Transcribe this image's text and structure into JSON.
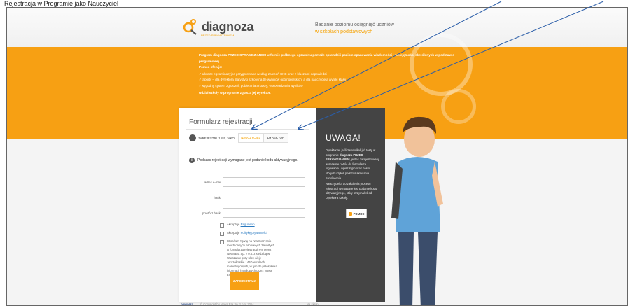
{
  "caption": "Rejestracja w Programie jako Nauczyciel",
  "header": {
    "logo_text": "diagnoza",
    "logo_subtext": "PRZED SPRAWDZIANEM",
    "tagline_line1": "Badanie poziomu osiągnięć uczniów",
    "tagline_line2": "w szkołach podstawowych"
  },
  "banner": {
    "intro": "Program diagnoza PRZED SPRAWDZIANEM w formie próbnego egzaminu pomoże sprawdzić poziom opanowania wiadomości i umiejętności określonych w podstawie programowej.",
    "offer_label": "Pomoc oferuje:",
    "items": [
      "arkusze egzaminacyjne przygotowane według zaleceń CKE oraz z kluczami odpowiedzi",
      "raporty – dla dyrektora statystyki szkoły na tle wyników ogólnopolskich, a dla nauczyciela wyniki klasy",
      "wygodny system zgłoszeń, pobierania arkuszy, wprowadzania wyników"
    ],
    "footer_note": "Udział szkoły w programie zgłasza jej Dyrektor."
  },
  "form": {
    "title": "Formularz rejestracji",
    "register_as_label": "ZAREJESTRUJ SIĘ JAKO:",
    "tab_teacher": "NAUCZYCIEL",
    "tab_director": "DYREKTOR",
    "info_text": "Podczas rejestracji wymagane jest podanie kodu aktywacyjnego.",
    "email_label": "adres e-mail",
    "password_label": "hasło",
    "password_repeat_label": "powtórz hasło",
    "email_value": "",
    "password_value": "",
    "password_repeat_value": "",
    "accept_prefix": "Akceptuję",
    "rules_link": "Regulamin",
    "privacy_link": "Politykę prywatności",
    "consent_text": "Wyrażam zgodę na przetwarzanie moich danych osobowych zawartych w formularzu rejestracyjnym przez Nowa Era Sp. z o.o. z siedzibą w Warszawie przy ulicy Aleje Jerozolimskie 146D w celach marketingowych, w tym do przesyłania informacji handlowych przez Nowa Era Sp. z o.o.",
    "submit_label": "ZAREJESTRUJ"
  },
  "uwaga": {
    "title": "UWAGA!",
    "p1_start": "Dyrektorze, jeśli zamówiłeś już testy w programie ",
    "p1_bold": "diagnoza PRZED SPRAWDZIANEM",
    "p1_end": ", jesteś zarejestrowany w serwisie. Wróć do formularza logowania i wpisz login oraz hasło, których użyłeś podczas składania zamówienia.",
    "p2": "Nauczycielu, do założenia procesu rejestracji wymagane jest podanie kodu aktywacyjnego, który otrzymałeś od Dyrektora szkoły.",
    "help_label": "POMOC"
  },
  "footer": {
    "logo": "nowaera",
    "copyright": "© Copyright by Nowa Era Sp. z o.o. 2014",
    "right_text": "Na skróty"
  },
  "colors": {
    "accent_orange": "#f7a013",
    "dark_panel": "#444444",
    "arrow_blue": "#2a5da8"
  }
}
